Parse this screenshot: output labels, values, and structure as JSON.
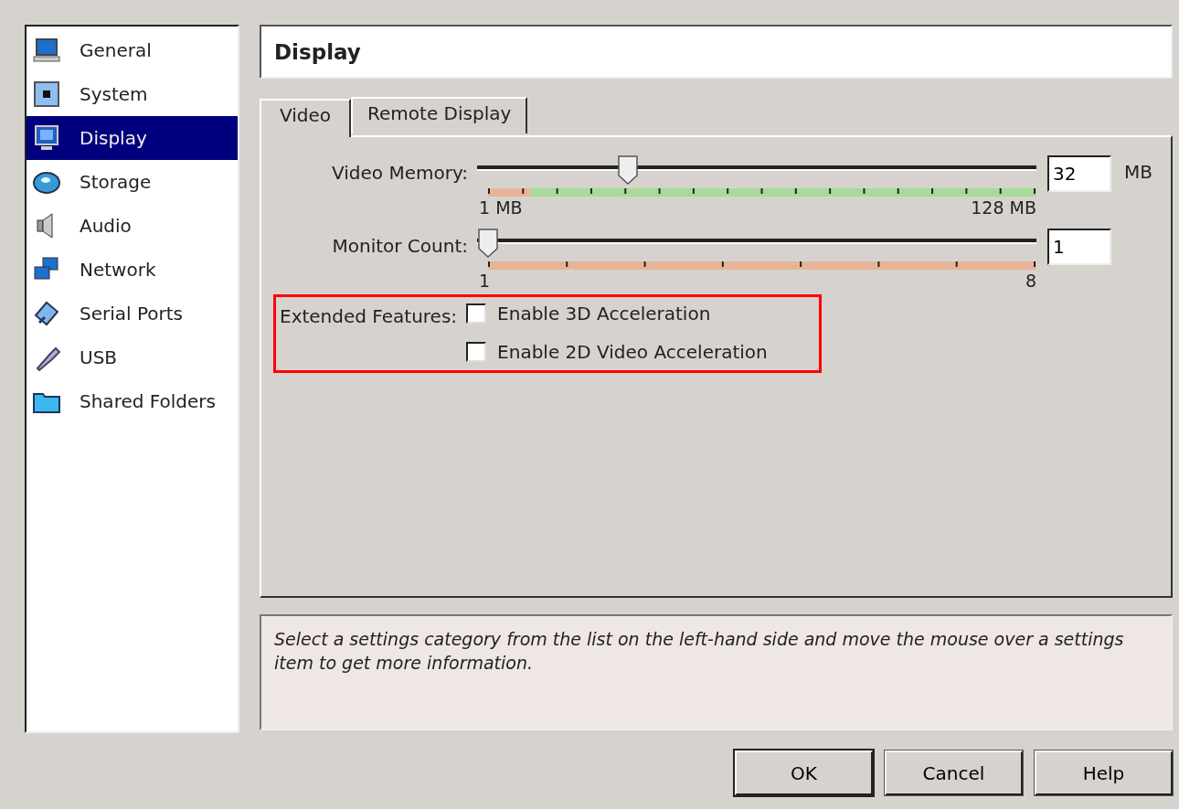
{
  "sidebar": {
    "items": [
      {
        "label": "General",
        "selected": false
      },
      {
        "label": "System",
        "selected": false
      },
      {
        "label": "Display",
        "selected": true
      },
      {
        "label": "Storage",
        "selected": false
      },
      {
        "label": "Audio",
        "selected": false
      },
      {
        "label": "Network",
        "selected": false
      },
      {
        "label": "Serial Ports",
        "selected": false
      },
      {
        "label": "USB",
        "selected": false
      },
      {
        "label": "Shared Folders",
        "selected": false
      }
    ]
  },
  "header": {
    "title": "Display"
  },
  "tabs": [
    {
      "label": "Video",
      "selected": true
    },
    {
      "label": "Remote Display",
      "selected": false
    }
  ],
  "sliders": [
    {
      "label": "Video Memory:",
      "level": 0.25,
      "min_label": "1 MB",
      "max_label": "128 MB",
      "value": "32",
      "unit": "MB"
    },
    {
      "label": "Monitor Count:",
      "level": 0,
      "min_label": "1",
      "max_label": "8",
      "value": "1"
    }
  ],
  "extended_features": {
    "label": "Extended Features:",
    "highlighted": true,
    "options": [
      {
        "label": "Enable 3D Acceleration",
        "checked": false
      },
      {
        "label": "Enable 2D Video Acceleration",
        "checked": false
      }
    ]
  },
  "info": {
    "text": "Select a settings category from the list on the left-hand side and move the mouse over a settings item to get more information."
  },
  "buttons": [
    {
      "label": "OK"
    },
    {
      "label": "Cancel"
    },
    {
      "label": "Help"
    }
  ]
}
